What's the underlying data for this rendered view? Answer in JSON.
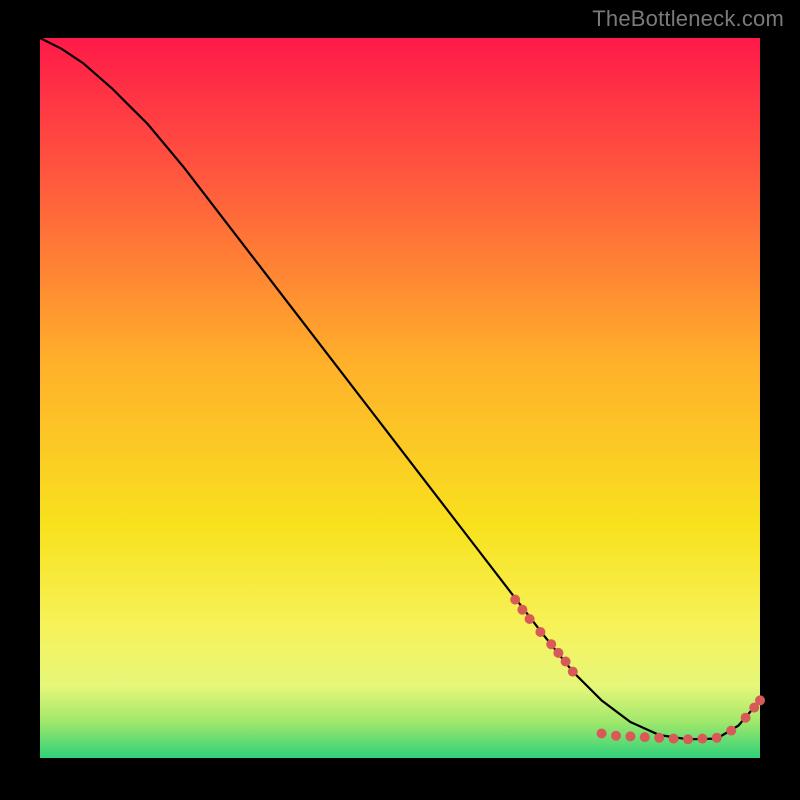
{
  "attribution": "TheBottleneck.com",
  "gradient": {
    "stops": [
      {
        "pct": 0,
        "color": "#ff1a49"
      },
      {
        "pct": 20,
        "color": "#ff5a3d"
      },
      {
        "pct": 45,
        "color": "#ffb02a"
      },
      {
        "pct": 68,
        "color": "#f8e21e"
      },
      {
        "pct": 82,
        "color": "#f6f25a"
      },
      {
        "pct": 90,
        "color": "#e6f77a"
      },
      {
        "pct": 95,
        "color": "#9fe86b"
      },
      {
        "pct": 100,
        "color": "#2fd17a"
      }
    ]
  },
  "chart_data": {
    "type": "line",
    "title": "",
    "xlabel": "",
    "ylabel": "",
    "xlim": [
      0,
      100
    ],
    "ylim": [
      0,
      100
    ],
    "series": [
      {
        "name": "curve",
        "color": "#000000",
        "x": [
          0,
          3,
          6,
          10,
          15,
          20,
          30,
          40,
          50,
          60,
          70,
          74,
          78,
          82,
          86,
          90,
          94,
          97,
          100
        ],
        "y": [
          100,
          98.5,
          96.5,
          93,
          88,
          82,
          69,
          56,
          43,
          30,
          17,
          12,
          8,
          5,
          3.2,
          2.6,
          2.7,
          4.5,
          8
        ]
      }
    ],
    "markers": [
      {
        "name": "upper-cluster",
        "color": "#d85a58",
        "x": [
          66,
          67,
          68,
          69.5,
          71,
          72,
          73,
          74
        ],
        "y": [
          22,
          20.6,
          19.3,
          17.5,
          15.8,
          14.6,
          13.4,
          12
        ]
      },
      {
        "name": "bottom-cluster",
        "color": "#d85a58",
        "x": [
          78,
          80,
          82,
          84,
          86,
          88,
          90,
          92,
          94,
          96,
          98,
          99.2,
          100
        ],
        "y": [
          3.4,
          3.1,
          3.0,
          2.9,
          2.8,
          2.7,
          2.6,
          2.7,
          2.8,
          3.8,
          5.6,
          7.0,
          8.0
        ]
      }
    ],
    "label": {
      "text": "",
      "x": 84,
      "y": 3.3
    }
  }
}
